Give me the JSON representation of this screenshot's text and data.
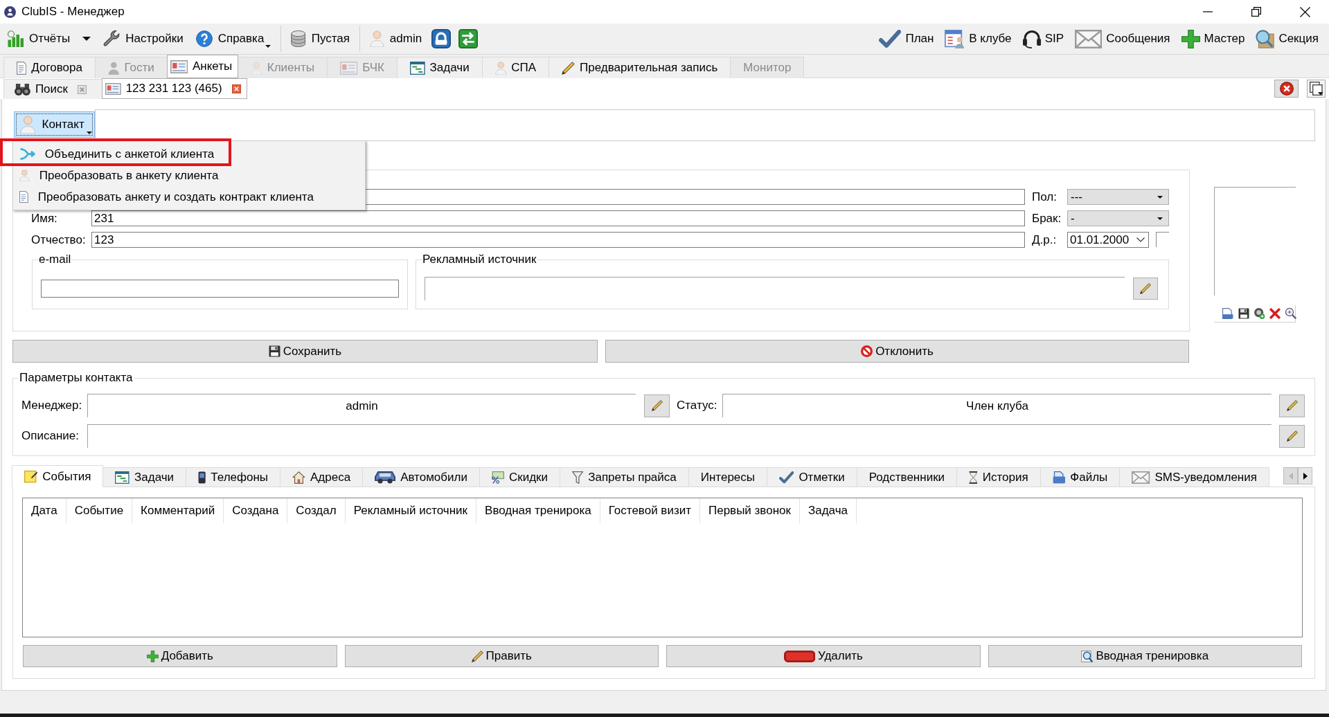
{
  "window": {
    "title": "ClubIS - Менеджер"
  },
  "toolbar": {
    "groups": [
      [
        {
          "label": "Отчёты",
          "kind": "split"
        },
        {
          "label": "Настройки",
          "kind": "plain"
        },
        {
          "label": "Справка",
          "kind": "menu"
        }
      ],
      [
        {
          "label": "Пустая",
          "kind": "plain"
        }
      ],
      [
        {
          "label": "admin",
          "kind": "plain"
        }
      ]
    ],
    "right": [
      {
        "label": "План"
      },
      {
        "label": "В клубе"
      },
      {
        "label": "SIP"
      },
      {
        "label": "Сообщения"
      },
      {
        "label": "Мастер"
      },
      {
        "label": "Секция"
      }
    ]
  },
  "main_tabs": [
    {
      "label": "Договора",
      "selected": false,
      "disabled": false
    },
    {
      "label": "Гости",
      "selected": false,
      "disabled": true
    },
    {
      "label": "Анкеты",
      "selected": true,
      "disabled": false
    },
    {
      "label": "Клиенты",
      "selected": false,
      "disabled": true
    },
    {
      "label": "БЧК",
      "selected": false,
      "disabled": true
    },
    {
      "label": "Задачи",
      "selected": false,
      "disabled": false
    },
    {
      "label": "СПА",
      "selected": false,
      "disabled": false
    },
    {
      "label": "Предварительная запись",
      "selected": false,
      "disabled": false
    },
    {
      "label": "Монитор",
      "selected": false,
      "disabled": true
    }
  ],
  "document_tabs": [
    {
      "label": "Поиск",
      "selected": false
    },
    {
      "label": "123 231 123 (465)",
      "selected": true
    }
  ],
  "contact": {
    "label": "Контакт",
    "expanded": true,
    "menu": [
      {
        "label": "Объединить с анкетой клиента",
        "highlighted": true
      },
      {
        "label": "Преобразовать в анкету клиента",
        "highlighted": false
      },
      {
        "label": "Преобразовать анкету и создать контракт клиента",
        "highlighted": false
      }
    ]
  },
  "person_form": {
    "rows": [
      {
        "kind": "select",
        "side_label": "Пол:",
        "side_value": "---"
      },
      {
        "kind": "select",
        "label": "Имя:",
        "value": "231",
        "side_label": "Брак:",
        "side_value": "-"
      },
      {
        "kind": "date",
        "label": "Отчество:",
        "value": "123",
        "side_label": "Д.р.:",
        "side_value": "01.01.2000"
      }
    ],
    "email": {
      "title": "e-mail"
    },
    "ad_source": {
      "title": "Рекламный источник"
    }
  },
  "form_buttons": [
    {
      "label": "Сохранить"
    },
    {
      "label": "Отклонить"
    }
  ],
  "contact_params": {
    "title": "Параметры контакта",
    "manager": {
      "label": "Менеджер:",
      "value": "admin"
    },
    "status": {
      "label": "Статус:",
      "value": "Член клуба"
    },
    "description": {
      "label": "Описание:"
    }
  },
  "detail_tabs": [
    {
      "label": "События",
      "selected": true
    },
    {
      "label": "Задачи",
      "selected": false
    },
    {
      "label": "Телефоны",
      "selected": false
    },
    {
      "label": "Адреса",
      "selected": false
    },
    {
      "label": "Автомобили",
      "selected": false
    },
    {
      "label": "Скидки",
      "selected": false
    },
    {
      "label": "Запреты прайса",
      "selected": false
    },
    {
      "label": "Интересы",
      "selected": false
    },
    {
      "label": "Отметки",
      "selected": false
    },
    {
      "label": "Родственники",
      "selected": false
    },
    {
      "label": "История",
      "selected": false
    },
    {
      "label": "Файлы",
      "selected": false
    },
    {
      "label": "SMS-уведомления",
      "selected": false
    }
  ],
  "detail_tab_scroll": {
    "back_disabled": true,
    "forward_disabled": false
  },
  "events_table": {
    "columns": [
      "Дата",
      "Событие",
      "Комментарий",
      "Создана",
      "Создал",
      "Рекламный источник",
      "Вводная тренирока",
      "Гостевой визит",
      "Первый звонок",
      "Задача"
    ]
  },
  "table_buttons": [
    {
      "label": "Добавить"
    },
    {
      "label": "Править"
    },
    {
      "label": "Удалить"
    },
    {
      "label": "Вводная тренировка"
    }
  ]
}
